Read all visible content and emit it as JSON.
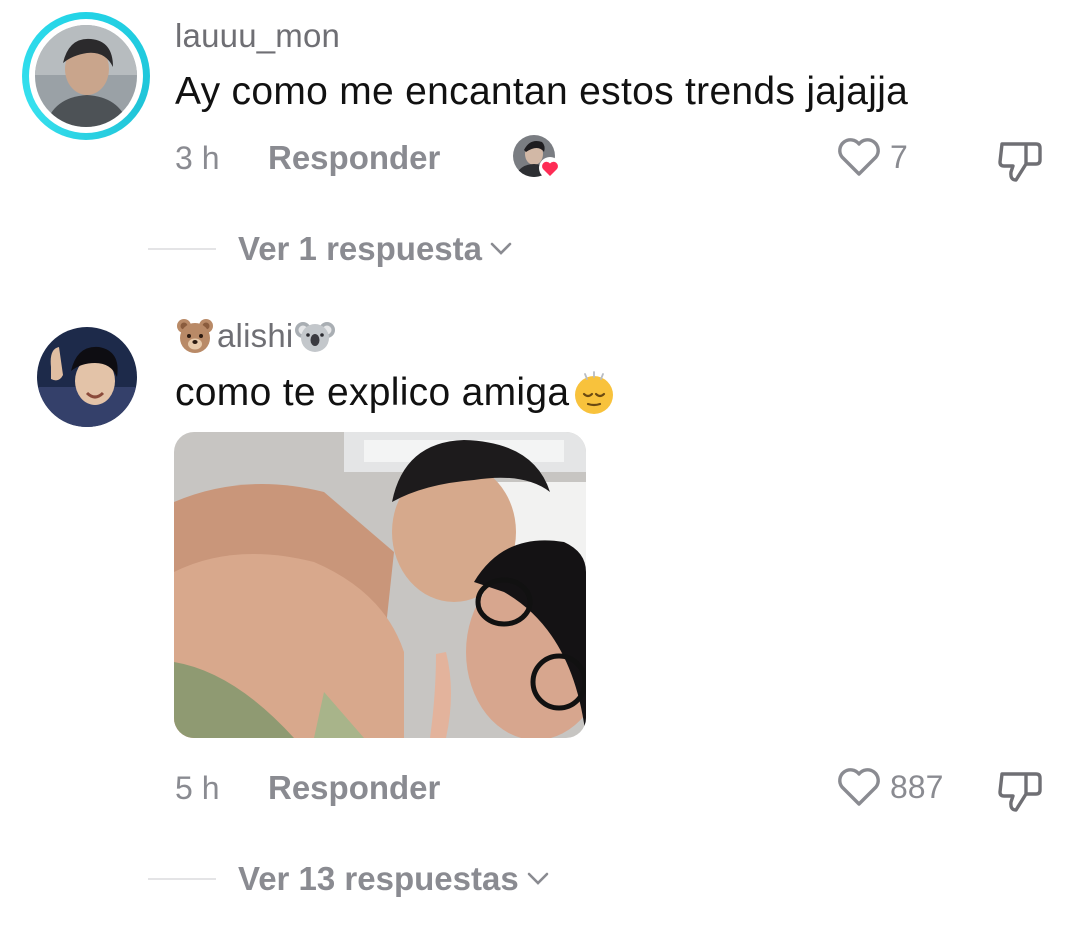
{
  "comments": [
    {
      "username": "lauuu_mon",
      "text": "Ay como me encantan estos trends jajajja",
      "time": "3 h",
      "reply_label": "Responder",
      "likes": "7",
      "replies_label": "Ver 1 respuesta",
      "avatar_icon": "user-avatar-photo",
      "has_story_ring": true,
      "creator_liked": true
    },
    {
      "username_prefix_emoji": "bear-face-emoji",
      "username": "alishi",
      "username_suffix_emoji": "koala-emoji",
      "text": "como te explico amiga",
      "text_emoji": "relieved-face-emoji",
      "time": "5 h",
      "reply_label": "Responder",
      "likes": "887",
      "replies_label": "Ver 13 respuestas",
      "avatar_icon": "user-avatar-photo",
      "attached_image": "couple-selfie-photo"
    }
  ],
  "colors": {
    "ring": "#22d3e6",
    "secondary_text": "#8a8b91",
    "heart_badge": "#fe2c55"
  }
}
